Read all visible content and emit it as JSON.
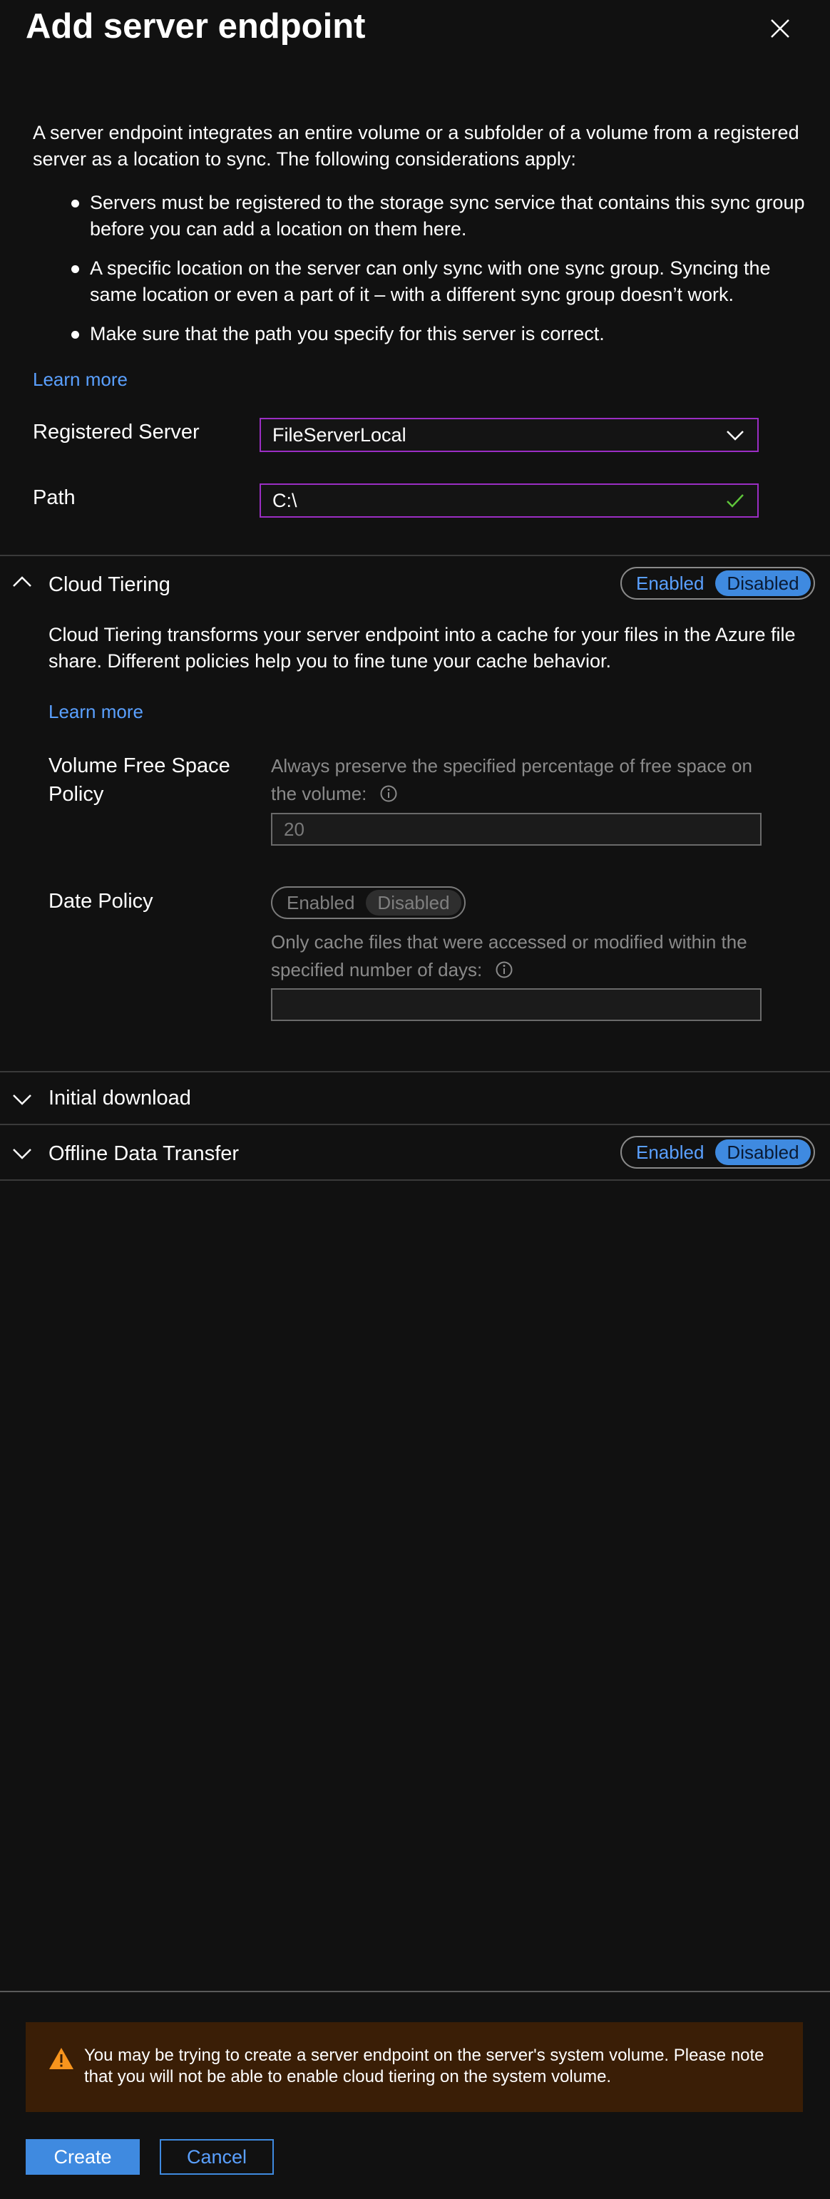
{
  "header": {
    "title": "Add server endpoint"
  },
  "intro": {
    "text": "A server endpoint integrates an entire volume or a subfolder of a volume from a registered server as a location to sync. The following considerations apply:",
    "bullets": [
      "Servers must be registered to the storage sync service that contains this sync group before you can add a location on them here.",
      "A specific location on the server can only sync with one sync group. Syncing the same location or even a part of it – with a different sync group doesn’t work.",
      "Make sure that the path you specify for this server is correct."
    ],
    "learn_more": "Learn more"
  },
  "form": {
    "registered_server_label": "Registered Server",
    "registered_server_value": "FileServerLocal",
    "path_label": "Path",
    "path_value": "C:\\"
  },
  "cloud_tiering": {
    "title": "Cloud Tiering",
    "toggle_enabled": "Enabled",
    "toggle_disabled": "Disabled",
    "description": "Cloud Tiering transforms your server endpoint into a cache for your files in the Azure file share. Different policies help you to fine tune your cache behavior.",
    "learn_more": "Learn more",
    "volume_policy_label": "Volume Free Space Policy",
    "volume_policy_hint": "Always preserve the specified percentage of free space on the volume:",
    "volume_policy_value": "20",
    "date_policy_label": "Date Policy",
    "date_toggle_enabled": "Enabled",
    "date_toggle_disabled": "Disabled",
    "date_policy_hint": "Only cache files that were accessed or modified within the specified number of days:",
    "date_policy_value": ""
  },
  "initial_download": {
    "title": "Initial download"
  },
  "offline_transfer": {
    "title": "Offline Data Transfer",
    "toggle_enabled": "Enabled",
    "toggle_disabled": "Disabled"
  },
  "warning": {
    "text": "You may be trying to create a server endpoint on the server's system volume. Please note that you will not be able to enable cloud tiering on the system volume."
  },
  "footer": {
    "create_label": "Create",
    "cancel_label": "Cancel"
  },
  "colors": {
    "accent": "#3f8ae0",
    "link": "#5aa0ff",
    "field_border": "#9b2ec4",
    "valid_check": "#5ec43a",
    "warning_bg": "#3a1e06",
    "warning_icon": "#f7941d"
  },
  "icons": {
    "close": "close-icon",
    "dropdown": "chevron-down-icon",
    "valid": "checkmark-icon",
    "expand": "chevron-down-icon",
    "collapse": "chevron-up-icon",
    "info": "info-icon",
    "warning": "warning-icon"
  }
}
